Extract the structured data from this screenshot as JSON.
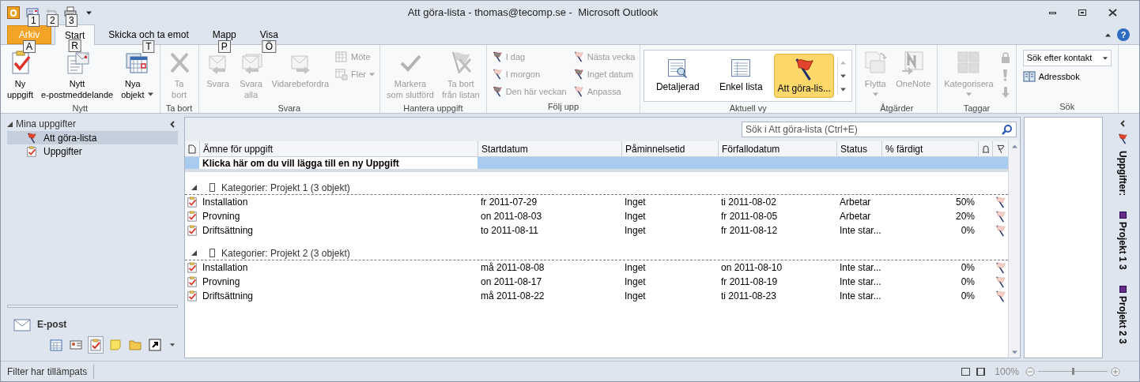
{
  "window": {
    "title": "Att göra-lista - thomas@tecomp.se -  Microsoft Outlook"
  },
  "quick_access": [
    {
      "keytip": "1",
      "disabled": false
    },
    {
      "keytip": "2",
      "disabled": true
    },
    {
      "keytip": "3",
      "disabled": false
    }
  ],
  "tabs": [
    {
      "label": "Arkiv",
      "keytip": "A",
      "kind": "file",
      "selected": false
    },
    {
      "label": "Start",
      "keytip": "R",
      "kind": "tab",
      "selected": true
    },
    {
      "label": "Skicka och ta emot",
      "keytip": "T",
      "kind": "tab",
      "selected": false
    },
    {
      "label": "Mapp",
      "keytip": "P",
      "kind": "tab",
      "selected": false
    },
    {
      "label": "Visa",
      "keytip": "Ö",
      "kind": "tab",
      "selected": false
    }
  ],
  "help_button": "?",
  "ribbon": {
    "groups": [
      {
        "label": "Nytt",
        "buttons": [
          {
            "kind": "large",
            "label": "Ny\nuppgift",
            "disabled": false,
            "has_menu": false
          },
          {
            "kind": "large",
            "label": "Nytt\ne-postmeddelande",
            "disabled": false,
            "has_menu": false
          },
          {
            "kind": "large",
            "label": "Nya\nobjekt",
            "disabled": false,
            "has_menu": true
          }
        ]
      },
      {
        "label": "Ta bort",
        "buttons": [
          {
            "kind": "large",
            "label": "Ta\nbort",
            "disabled": true,
            "has_menu": false
          }
        ]
      },
      {
        "label": "Svara",
        "buttons": [
          {
            "kind": "large",
            "label": "Svara",
            "disabled": true,
            "has_menu": false
          },
          {
            "kind": "large",
            "label": "Svara\nalla",
            "disabled": true,
            "has_menu": false
          },
          {
            "kind": "large",
            "label": "Vidarebefordra",
            "disabled": true,
            "has_menu": false
          },
          {
            "kind": "small",
            "label": "Möte",
            "disabled": true,
            "has_menu": false
          },
          {
            "kind": "small",
            "label": "Fler",
            "disabled": true,
            "has_menu": true
          }
        ]
      },
      {
        "label": "Hantera uppgift",
        "buttons": [
          {
            "kind": "large",
            "label": "Markera\nsom slutförd",
            "disabled": true,
            "has_menu": false
          },
          {
            "kind": "large",
            "label": "Ta bort\nfrån listan",
            "disabled": true,
            "has_menu": false
          }
        ]
      },
      {
        "label": "Följ upp",
        "buttons": [
          {
            "kind": "small",
            "label": "I dag",
            "disabled": true,
            "has_menu": false
          },
          {
            "kind": "small",
            "label": "I morgon",
            "disabled": true,
            "has_menu": false
          },
          {
            "kind": "small",
            "label": "Den här veckan",
            "disabled": true,
            "has_menu": false
          },
          {
            "kind": "small",
            "label": "Nästa vecka",
            "disabled": true,
            "has_menu": false
          },
          {
            "kind": "small",
            "label": "Inget datum",
            "disabled": true,
            "has_menu": false
          },
          {
            "kind": "small",
            "label": "Anpassa",
            "disabled": true,
            "has_menu": false
          }
        ]
      },
      {
        "label": "Aktuell vy",
        "buttons": [
          {
            "kind": "gallery",
            "label": "Detaljerad",
            "selected": false
          },
          {
            "kind": "gallery",
            "label": "Enkel lista",
            "selected": false
          },
          {
            "kind": "gallery",
            "label": "Att göra-lis...",
            "selected": true
          }
        ]
      },
      {
        "label": "Åtgärder",
        "buttons": [
          {
            "kind": "large",
            "label": "Flytta",
            "disabled": true,
            "has_menu": true
          },
          {
            "kind": "large",
            "label": "OneNote",
            "disabled": true,
            "has_menu": false
          }
        ]
      },
      {
        "label": "Taggar",
        "buttons": [
          {
            "kind": "large",
            "label": "Kategorisera",
            "disabled": true,
            "has_menu": true
          },
          {
            "kind": "icon",
            "disabled": true
          },
          {
            "kind": "icon",
            "disabled": true
          },
          {
            "kind": "icon",
            "disabled": true
          }
        ]
      },
      {
        "label": "Sök",
        "buttons": [
          {
            "kind": "combo",
            "label": "Sök efter kontakt"
          },
          {
            "kind": "link",
            "label": "Adressbok"
          }
        ]
      }
    ]
  },
  "navigation": {
    "header": {
      "label": "Mina uppgifter",
      "expanded": true
    },
    "items": [
      {
        "label": "Att göra-lista",
        "selected": true
      },
      {
        "label": "Uppgifter",
        "selected": false
      }
    ],
    "mail_button": "E-post",
    "shortcuts": [
      {
        "selected": false
      },
      {
        "selected": false
      },
      {
        "selected": true
      },
      {
        "selected": false
      },
      {
        "selected": false
      },
      {
        "selected": false
      }
    ]
  },
  "search": {
    "placeholder": "Sök i Att göra-lista (Ctrl+E)"
  },
  "table": {
    "columns": [
      "Ämne för uppgift",
      "Startdatum",
      "Påminnelsetid",
      "Förfallodatum",
      "Status",
      "% färdigt"
    ],
    "new_item_prompt": "Klicka här om du vill lägga till en ny Uppgift",
    "groups": [
      {
        "label": "Kategorier: Projekt 1 (3 objekt)",
        "expanded": true,
        "rows": [
          {
            "subject": "Installation",
            "start": "fr 2011-07-29",
            "reminder": "Inget",
            "due": "ti 2011-08-02",
            "status": "Arbetar",
            "percent": "50%"
          },
          {
            "subject": "Provning",
            "start": "on 2011-08-03",
            "reminder": "Inget",
            "due": "fr 2011-08-05",
            "status": "Arbetar",
            "percent": "20%"
          },
          {
            "subject": "Driftsättning",
            "start": "to 2011-08-11",
            "reminder": "Inget",
            "due": "fr 2011-08-12",
            "status": "Inte star...",
            "percent": "0%"
          }
        ]
      },
      {
        "label": "Kategorier: Projekt 2 (3 objekt)",
        "expanded": true,
        "rows": [
          {
            "subject": "Installation",
            "start": "må 2011-08-08",
            "reminder": "Inget",
            "due": "on 2011-08-10",
            "status": "Inte star...",
            "percent": "0%"
          },
          {
            "subject": "Provning",
            "start": "on 2011-08-17",
            "reminder": "Inget",
            "due": "fr 2011-08-19",
            "status": "Inte star...",
            "percent": "0%"
          },
          {
            "subject": "Driftsättning",
            "start": "må 2011-08-22",
            "reminder": "Inget",
            "due": "ti 2011-08-23",
            "status": "Inte star...",
            "percent": "0%"
          }
        ]
      }
    ]
  },
  "todo_bar": {
    "title": "Uppgifter:",
    "categories": [
      {
        "label": "Projekt 1",
        "count": "3"
      },
      {
        "label": "Projekt 2",
        "count": "3"
      }
    ]
  },
  "status_bar": {
    "text": "Filter har tillämpats",
    "zoom": "100%",
    "zoom_slider": {
      "level": 0.5
    }
  }
}
